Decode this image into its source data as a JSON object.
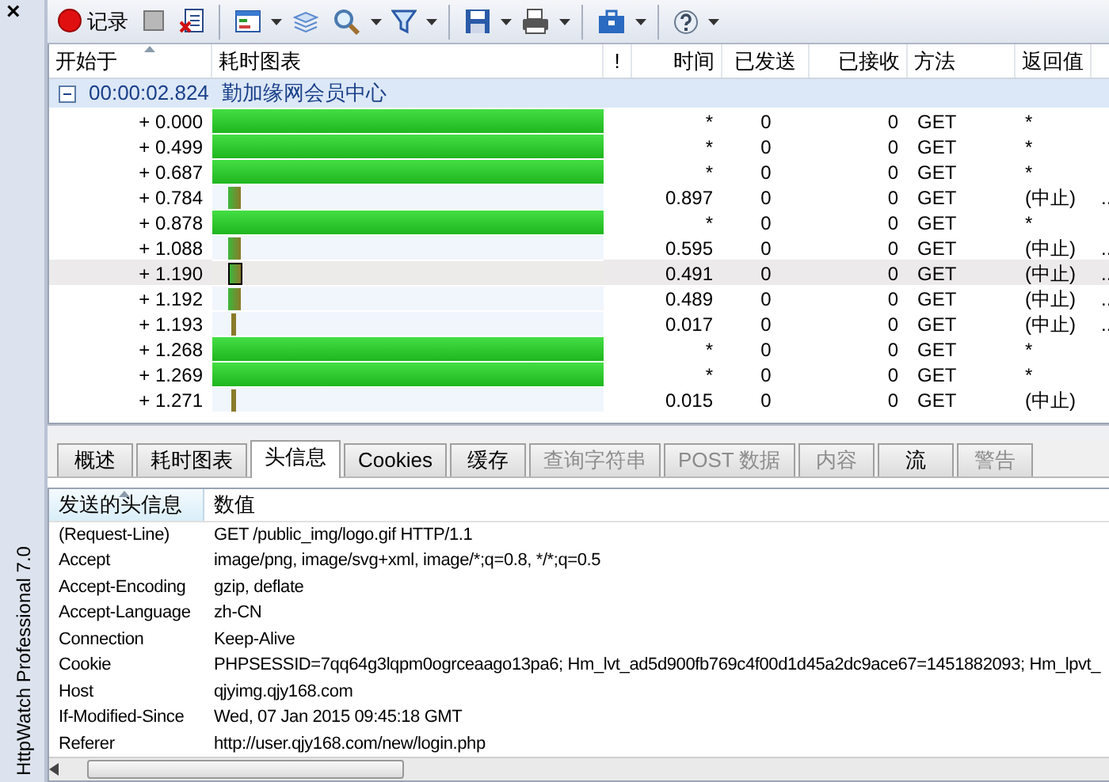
{
  "side_panel": {
    "close": "×",
    "title": "HttpWatch Professional 7.0"
  },
  "toolbar": [
    {
      "kind": "record",
      "label": "记录"
    },
    {
      "kind": "stop"
    },
    {
      "kind": "clear"
    },
    {
      "kind": "sep"
    },
    {
      "kind": "view",
      "caret": true
    },
    {
      "kind": "layers"
    },
    {
      "kind": "search",
      "caret": true
    },
    {
      "kind": "filter",
      "caret": true
    },
    {
      "kind": "sep"
    },
    {
      "kind": "save",
      "caret": true
    },
    {
      "kind": "print",
      "caret": true
    },
    {
      "kind": "sep"
    },
    {
      "kind": "toolbox",
      "caret": true
    },
    {
      "kind": "sep"
    },
    {
      "kind": "help",
      "caret": true
    }
  ],
  "grid": {
    "columns": [
      {
        "label": "开始于",
        "sorted": true
      },
      {
        "label": "耗时图表",
        "sorted": false
      },
      {
        "label": "!",
        "sorted": false
      },
      {
        "label": "时间",
        "sorted": false
      },
      {
        "label": "已发送",
        "sorted": false
      },
      {
        "label": "已接收",
        "sorted": false
      },
      {
        "label": "方法",
        "sorted": false
      },
      {
        "label": "返回值",
        "sorted": false
      }
    ],
    "group": {
      "expanded": true,
      "time": "00:00:02.824",
      "title": "勤加缘网会员中心"
    },
    "rows": [
      {
        "start": "+ 0.000",
        "kind": "full",
        "time": "*",
        "sent": "0",
        "received": "0",
        "method": "GET",
        "result": "*",
        "selected": false
      },
      {
        "start": "+ 0.499",
        "kind": "full",
        "time": "*",
        "sent": "0",
        "received": "0",
        "method": "GET",
        "result": "*",
        "selected": false
      },
      {
        "start": "+ 0.687",
        "kind": "full",
        "time": "*",
        "sent": "0",
        "received": "0",
        "method": "GET",
        "result": "*",
        "selected": false
      },
      {
        "start": "+ 0.784",
        "kind": "short",
        "time": "0.897",
        "sent": "0",
        "received": "0",
        "method": "GET",
        "result": "(中止)",
        "column_9": "..",
        "selected": false
      },
      {
        "start": "+ 0.878",
        "kind": "full",
        "time": "*",
        "sent": "0",
        "received": "0",
        "method": "GET",
        "result": "*",
        "selected": false
      },
      {
        "start": "+ 1.088",
        "kind": "short",
        "time": "0.595",
        "sent": "0",
        "received": "0",
        "method": "GET",
        "result": "(中止)",
        "column_9": "..",
        "selected": false
      },
      {
        "start": "+ 1.190",
        "kind": "short",
        "time": "0.491",
        "sent": "0",
        "received": "0",
        "method": "GET",
        "result": "(中止)",
        "column_9": "..",
        "selected": true
      },
      {
        "start": "+ 1.192",
        "kind": "short",
        "time": "0.489",
        "sent": "0",
        "received": "0",
        "method": "GET",
        "result": "(中止)",
        "column_9": "..",
        "selected": false
      },
      {
        "start": "+ 1.193",
        "kind": "thin",
        "time": "0.017",
        "sent": "0",
        "received": "0",
        "method": "GET",
        "result": "(中止)",
        "column_9": "..",
        "selected": false
      },
      {
        "start": "+ 1.268",
        "kind": "full",
        "time": "*",
        "sent": "0",
        "received": "0",
        "method": "GET",
        "result": "*",
        "selected": false
      },
      {
        "start": "+ 1.269",
        "kind": "full",
        "time": "*",
        "sent": "0",
        "received": "0",
        "method": "GET",
        "result": "*",
        "selected": false
      },
      {
        "start": "+ 1.271",
        "kind": "thin",
        "time": "0.015",
        "sent": "0",
        "received": "0",
        "method": "GET",
        "result": "(中止)",
        "selected": false
      }
    ]
  },
  "tabs": [
    {
      "label": "概述",
      "selected": false,
      "disabled": false
    },
    {
      "label": "耗时图表",
      "selected": false,
      "disabled": false
    },
    {
      "label": "头信息",
      "selected": true,
      "disabled": false
    },
    {
      "label": "Cookies",
      "selected": false,
      "disabled": false
    },
    {
      "label": "缓存",
      "selected": false,
      "disabled": false
    },
    {
      "label": "查询字符串",
      "selected": false,
      "disabled": true
    },
    {
      "label": "POST 数据",
      "selected": false,
      "disabled": true
    },
    {
      "label": "内容",
      "selected": false,
      "disabled": true
    },
    {
      "label": "流",
      "selected": false,
      "disabled": false
    },
    {
      "label": "警告",
      "selected": false,
      "disabled": true
    }
  ],
  "headers": {
    "columns": [
      {
        "label": "发送的头信息",
        "sorted": true
      },
      {
        "label": "数值",
        "sorted": false
      }
    ],
    "rows": [
      {
        "name": "(Request-Line)",
        "value": "GET /public_img/logo.gif HTTP/1.1"
      },
      {
        "name": "Accept",
        "value": "image/png, image/svg+xml, image/*;q=0.8, */*;q=0.5"
      },
      {
        "name": "Accept-Encoding",
        "value": "gzip, deflate"
      },
      {
        "name": "Accept-Language",
        "value": "zh-CN"
      },
      {
        "name": "Connection",
        "value": "Keep-Alive"
      },
      {
        "name": "Cookie",
        "value": "PHPSESSID=7qq64g3lqpm0ogrceaago13pa6; Hm_lvt_ad5d900fb769c4f00d1d45a2dc9ace67=1451882093; Hm_lpvt_"
      },
      {
        "name": "Host",
        "value": "qjyimg.qjy168.com"
      },
      {
        "name": "If-Modified-Since",
        "value": "Wed, 07 Jan 2015 09:45:18 GMT"
      },
      {
        "name": "Referer",
        "value": "http://user.qjy168.com/new/login.php"
      }
    ]
  }
}
